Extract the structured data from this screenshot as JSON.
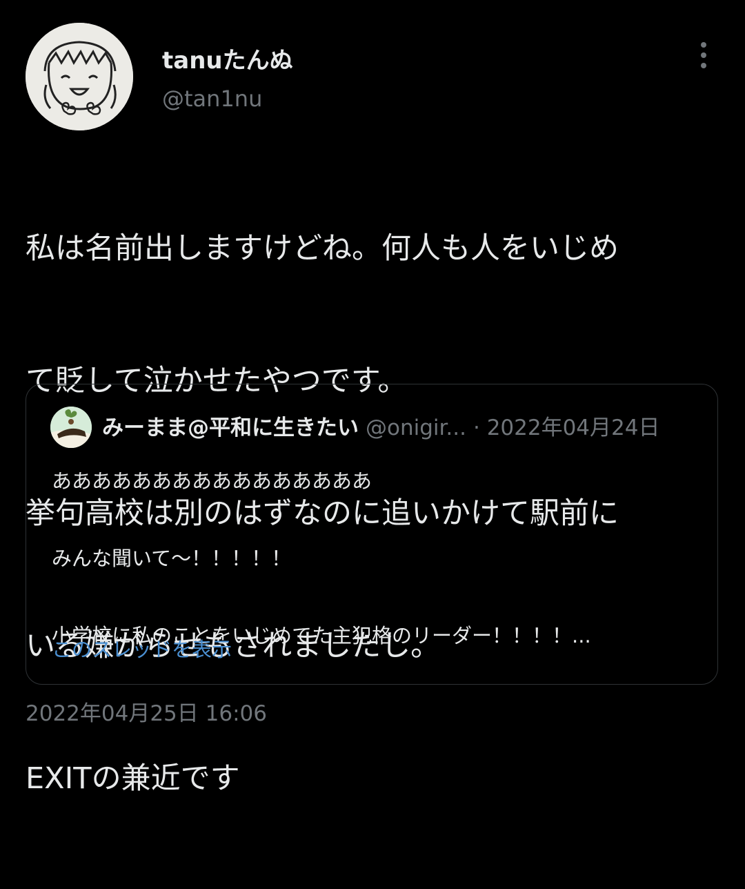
{
  "author": {
    "display_name": "tanuたんぬ",
    "handle": "@tan1nu"
  },
  "icons": {
    "more": "more-options-icon",
    "avatar": "avatar"
  },
  "tweet": {
    "lines": [
      "私は名前出しますけどね。何人も人をいじめ",
      "て貶して泣かせたやつです。",
      "挙句高校は別のはずなのに追いかけて駅前に",
      "いる嫌がらせもされましたし。",
      "EXITの兼近です"
    ],
    "timestamp": "2022年04月25日 16:06"
  },
  "quote": {
    "display_name": "みーまま@平和に生きたい",
    "handle": "@onigir...",
    "date": "· 2022年04月24日",
    "body": {
      "line1": "ああああああああああああああああ",
      "line2": "みんな聞いて〜！！！！！",
      "line3": "小学校に私のことをいじめてた主犯格のリーダー！！！！..."
    },
    "show_thread": "このスレッドを表示"
  },
  "colors": {
    "background": "#000000",
    "text_primary": "#e7e9ea",
    "text_secondary": "#71767b",
    "link": "#4a8fd1",
    "border": "#2f3336"
  }
}
